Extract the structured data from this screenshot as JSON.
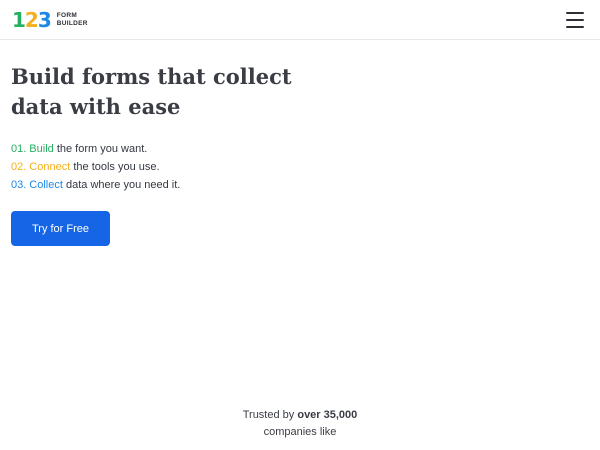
{
  "header": {
    "logo": {
      "digits": [
        "1",
        "2",
        "3"
      ],
      "digit_colors": [
        "#27ae60",
        "#f2b01e",
        "#1e88e5"
      ],
      "line1": "FORM",
      "line2": "BUILDER"
    },
    "menu_icon": "hamburger-menu-icon"
  },
  "hero": {
    "title_line1": "Build forms that collect",
    "title_line2": "data with ease",
    "steps": [
      {
        "num": "01.",
        "keyword": "Build",
        "rest": "the form you want.",
        "color": "#27ae60"
      },
      {
        "num": "02.",
        "keyword": "Connect",
        "rest": "the tools you use.",
        "color": "#f2b01e"
      },
      {
        "num": "03.",
        "keyword": "Collect",
        "rest": "data where you need it.",
        "color": "#1e88e5"
      }
    ],
    "cta_label": "Try for Free",
    "cta_color": "#1565e6"
  },
  "trusted": {
    "prefix": "Trusted by",
    "highlight": "over 35,000",
    "line2": "companies like"
  }
}
